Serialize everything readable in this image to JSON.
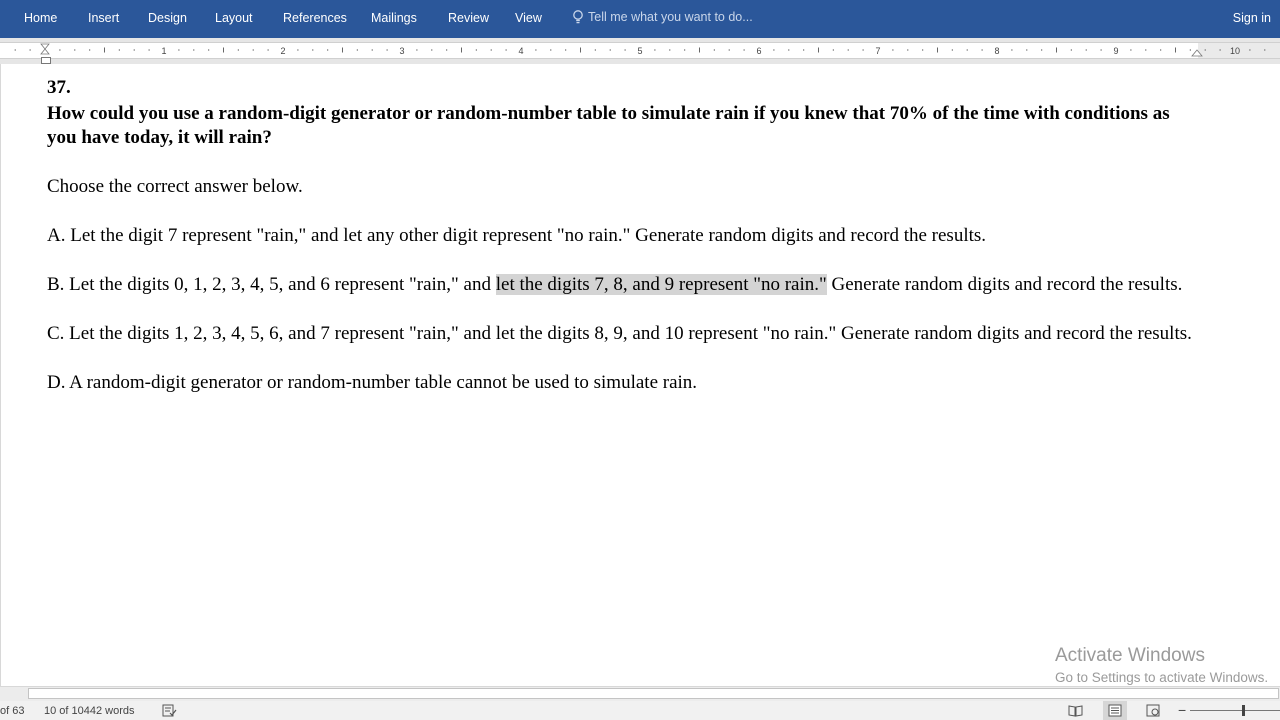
{
  "ribbon": {
    "tabs": [
      "Home",
      "Insert",
      "Design",
      "Layout",
      "References",
      "Mailings",
      "Review",
      "View"
    ],
    "tell_me": "Tell me what you want to do...",
    "sign_in": "Sign in"
  },
  "ruler": {
    "numbers": [
      "1",
      "2",
      "3",
      "4",
      "5",
      "6",
      "7",
      "8",
      "9",
      "10"
    ]
  },
  "document": {
    "question_number": "37.",
    "question_text": "How could you use a random-digit generator or random-number table to simulate rain if you knew that 70% of the time with conditions as you have today, it will rain?",
    "instruction": "Choose the correct answer below.",
    "option_a": "A. Let the digit 7 represent \"rain,\" and let any other digit represent \"no rain.\" Generate random digits and record the results.",
    "option_b_before": "B. Let the digits 0, 1, 2, 3, 4, 5, and 6 represent \"rain,\" and ",
    "option_b_highlight": "let the digits 7, 8, and 9 represent \"no rain.\"",
    "option_b_after": " Generate random digits and record the results.",
    "option_c": "C. Let the digits 1, 2, 3, 4, 5, 6, and 7 represent \"rain,\" and let the digits 8, 9, and 10 represent \"no rain.\" Generate random digits and record the results.",
    "option_d": "D. A random-digit generator or random-number table cannot be used to simulate rain.",
    "highlight_color": "#d4d4d4"
  },
  "watermark": {
    "line1": "Activate Windows",
    "line2": "Go to Settings to activate Windows."
  },
  "status_bar": {
    "page_info": "of 63",
    "word_count": "10 of 10442 words",
    "proofing_icon": "proofing-icon",
    "view_icons": [
      "read-mode-icon",
      "print-layout-icon",
      "web-layout-icon"
    ],
    "zoom_minus": "−"
  },
  "colors": {
    "ribbon": "#2b579a",
    "status_bar": "#f1f1f1"
  }
}
